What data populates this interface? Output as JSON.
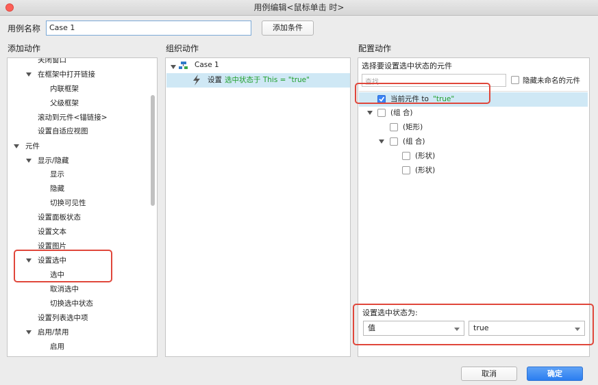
{
  "window": {
    "title": "用例编辑<鼠标单击 时>"
  },
  "case_name": {
    "label": "用例名称",
    "value": "Case 1",
    "add_condition": "添加条件"
  },
  "add_actions": {
    "heading": "添加动作",
    "items": [
      "关闭窗口",
      "在框架中打开链接",
      "内联框架",
      "父级框架",
      "滚动到元件<锚链接>",
      "设置自适应视图",
      "元件",
      "显示/隐藏",
      "显示",
      "隐藏",
      "切换可见性",
      "设置面板状态",
      "设置文本",
      "设置图片",
      "设置选中",
      "选中",
      "取消选中",
      "切换选中状态",
      "设置列表选中项",
      "启用/禁用",
      "启用"
    ]
  },
  "organize_actions": {
    "heading": "组织动作",
    "case_label": "Case 1",
    "action_prefix": "设置",
    "action_detail": "选中状态于 This = \"true\""
  },
  "configure_actions": {
    "heading": "配置动作",
    "select_label": "选择要设置选中状态的元件",
    "search_placeholder": "查找",
    "hide_unnamed": "隐藏未命名的元件",
    "tree": {
      "current_prefix": "当前元件 to",
      "current_value": "\"true\"",
      "items": [
        "(组 合)",
        "(矩形)",
        "(组 合)",
        "(形状)",
        "(形状)"
      ]
    },
    "set_state_label": "设置选中状态为:",
    "mode_select": "值",
    "value_select": "true"
  },
  "footer": {
    "cancel": "取消",
    "ok": "确定"
  }
}
